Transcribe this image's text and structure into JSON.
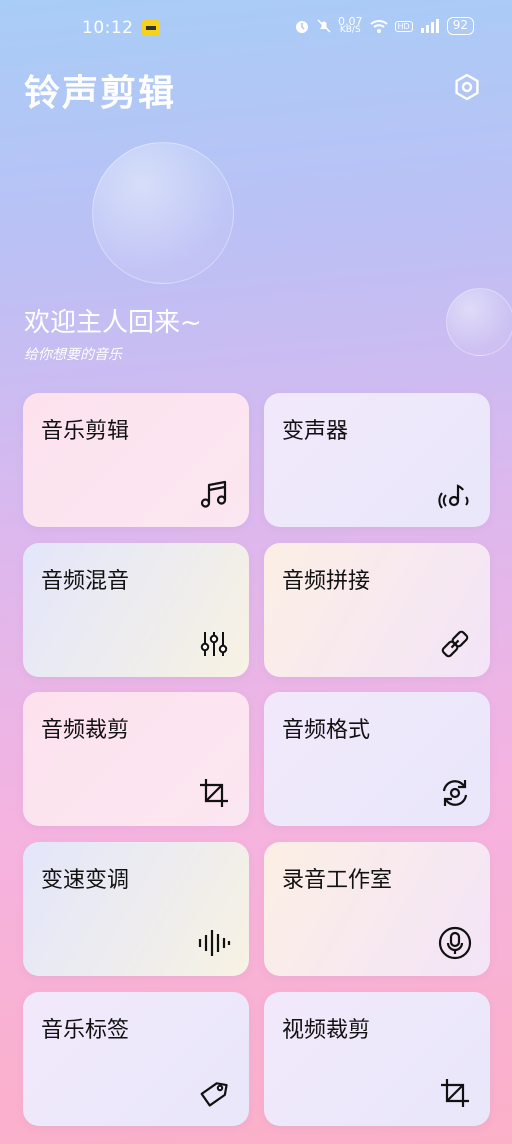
{
  "status_bar": {
    "time": "10:12",
    "net_speed": "0.07",
    "net_unit": "KB/S",
    "hd_badge": "HD",
    "battery": "92"
  },
  "header": {
    "title": "铃声剪辑"
  },
  "welcome": {
    "greeting": "欢迎主人回来~",
    "subtitle": "给你想要的音乐"
  },
  "cards": [
    {
      "label": "音乐剪辑",
      "icon": "music-note-icon"
    },
    {
      "label": "变声器",
      "icon": "voice-changer-icon"
    },
    {
      "label": "音频混音",
      "icon": "equalizer-icon"
    },
    {
      "label": "音频拼接",
      "icon": "link-icon"
    },
    {
      "label": "音频裁剪",
      "icon": "crop-icon"
    },
    {
      "label": "音频格式",
      "icon": "format-convert-icon"
    },
    {
      "label": "变速变调",
      "icon": "waveform-icon"
    },
    {
      "label": "录音工作室",
      "icon": "microphone-icon"
    },
    {
      "label": "音乐标签",
      "icon": "tag-icon"
    },
    {
      "label": "视频裁剪",
      "icon": "crop-icon"
    }
  ]
}
